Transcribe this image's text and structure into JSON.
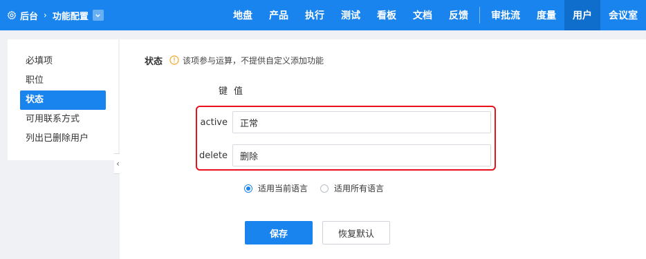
{
  "header": {
    "breadcrumb": {
      "root": "后台",
      "current": "功能配置"
    },
    "nav": [
      {
        "label": "地盘"
      },
      {
        "label": "产品"
      },
      {
        "label": "执行"
      },
      {
        "label": "测试"
      },
      {
        "label": "看板"
      },
      {
        "label": "文档"
      },
      {
        "label": "反馈"
      },
      {
        "label": "审批流"
      },
      {
        "label": "度量"
      },
      {
        "label": "用户",
        "active": true
      },
      {
        "label": "会议室"
      }
    ]
  },
  "sidebar": {
    "items": [
      {
        "label": "必填项"
      },
      {
        "label": "职位"
      },
      {
        "label": "状态",
        "active": true
      },
      {
        "label": "可用联系方式"
      },
      {
        "label": "列出已删除用户"
      }
    ]
  },
  "main": {
    "section_title": "状态",
    "info_text": "该项参与运算，不提供自定义添加功能",
    "col_key": "键",
    "col_value": "值",
    "rows": [
      {
        "key": "active",
        "value": "正常"
      },
      {
        "key": "delete",
        "value": "删除"
      }
    ],
    "radio": {
      "current_lang": "适用当前语言",
      "all_lang": "适用所有语言",
      "selected": "current_lang"
    },
    "buttons": {
      "save": "保存",
      "reset": "恢复默认"
    }
  },
  "colors": {
    "primary": "#1a84ee",
    "highlight": "#e8101b",
    "info_icon": "#f5a623"
  }
}
